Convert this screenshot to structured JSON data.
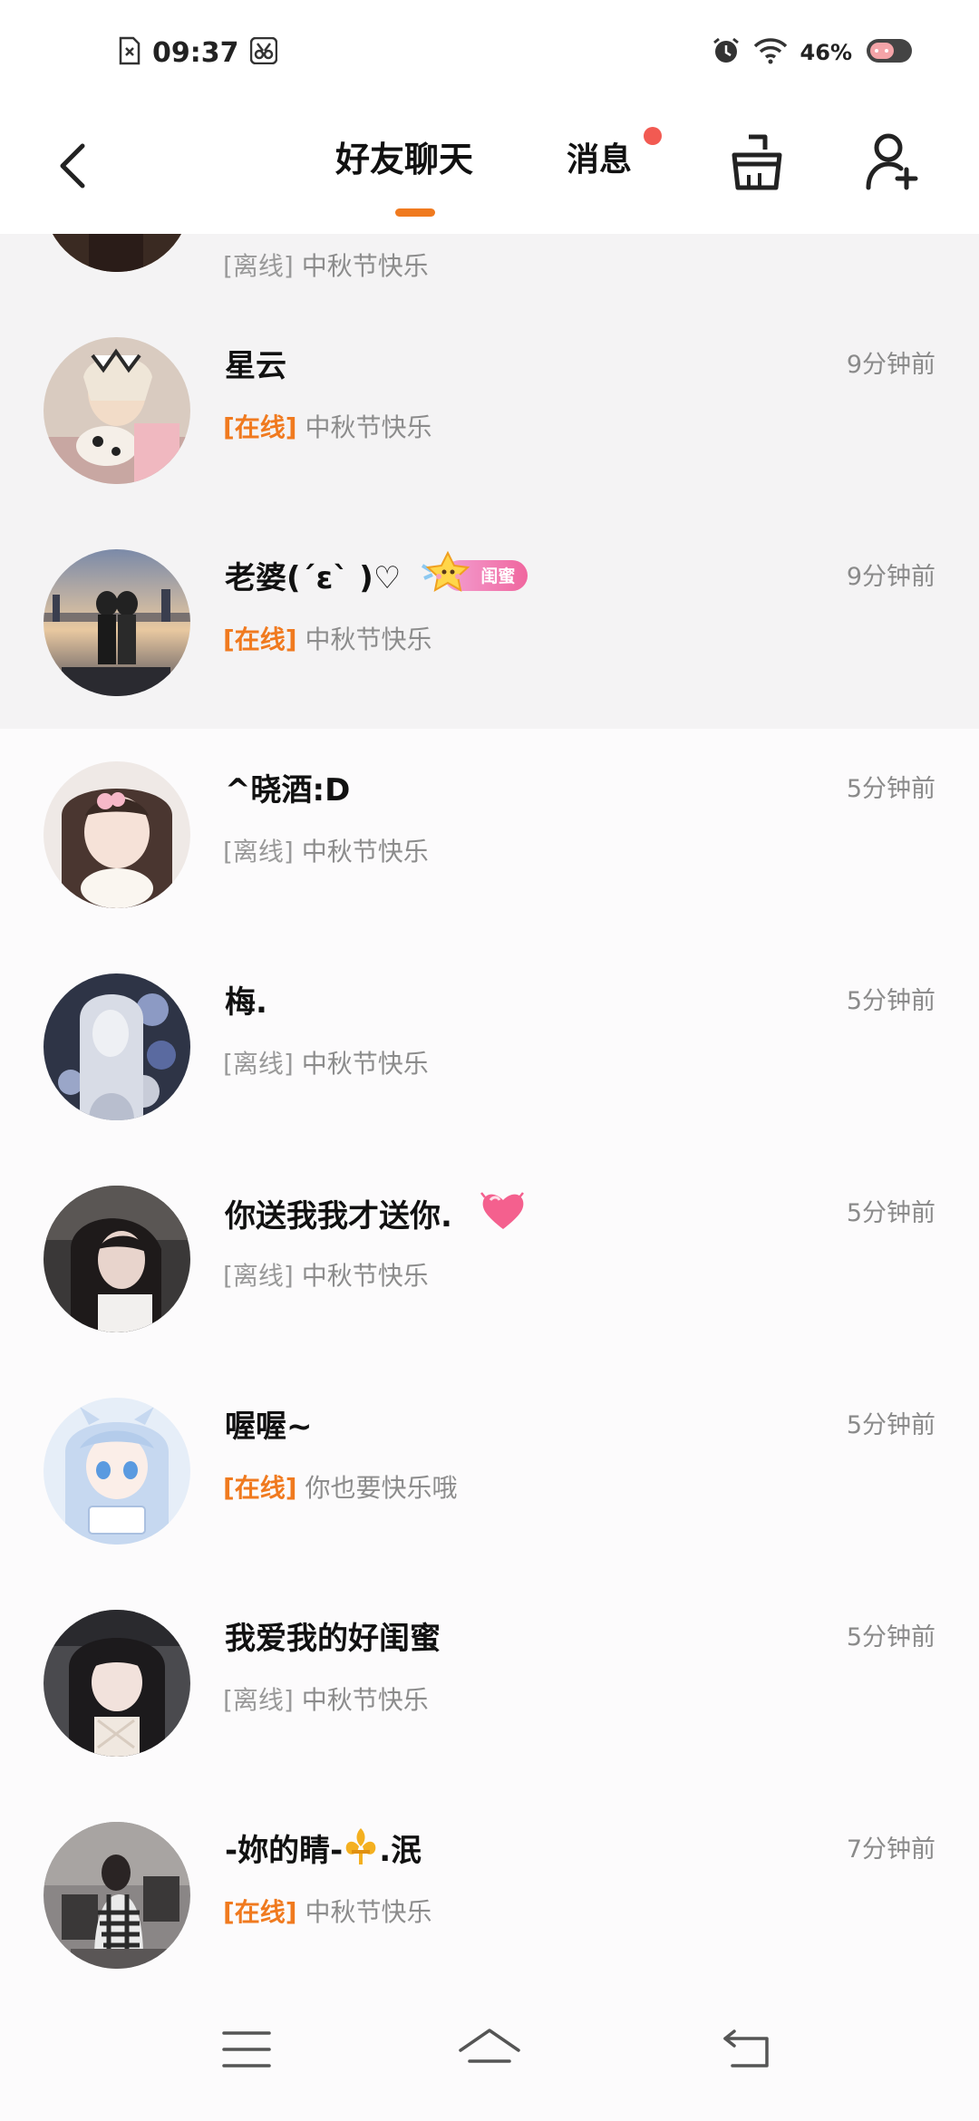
{
  "status_bar": {
    "time": "09:37",
    "battery": "46%"
  },
  "header": {
    "tab_friends": "好友聊天",
    "tab_messages": "消息",
    "accent": "#f07a1f",
    "icons": [
      "back-icon",
      "broom-icon",
      "add-friend-icon"
    ]
  },
  "chats": [
    {
      "name": "",
      "time": "",
      "status": "[离线]",
      "message": "中秋节快乐"
    },
    {
      "name": "星云",
      "time": "9分钟前",
      "status": "[在线]",
      "message": "中秋节快乐"
    },
    {
      "name": "老婆(´ε` )♡",
      "time": "9分钟前",
      "status": "[在线]",
      "message": "中秋节快乐",
      "badge": "闺蜜"
    },
    {
      "name": "^晓酒:D",
      "time": "5分钟前",
      "status": "[离线]",
      "message": "中秋节快乐"
    },
    {
      "name": "梅.",
      "time": "5分钟前",
      "status": "[离线]",
      "message": "中秋节快乐"
    },
    {
      "name": "你送我我才送你.",
      "time": "5分钟前",
      "status": "[离线]",
      "message": "中秋节快乐"
    },
    {
      "name": "喔喔~",
      "time": "5分钟前",
      "status": "[在线]",
      "message": "你也要快乐哦"
    },
    {
      "name": "我爱我的好闺蜜",
      "time": "5分钟前",
      "status": "[离线]",
      "message": "中秋节快乐"
    },
    {
      "name": "-妳的睛-",
      "name_suffix": ".泯",
      "time": "7分钟前",
      "status": "[在线]",
      "message": "中秋节快乐"
    }
  ],
  "nav_bar": {
    "icons": [
      "menu-icon",
      "home-icon",
      "back-nav-icon"
    ]
  }
}
